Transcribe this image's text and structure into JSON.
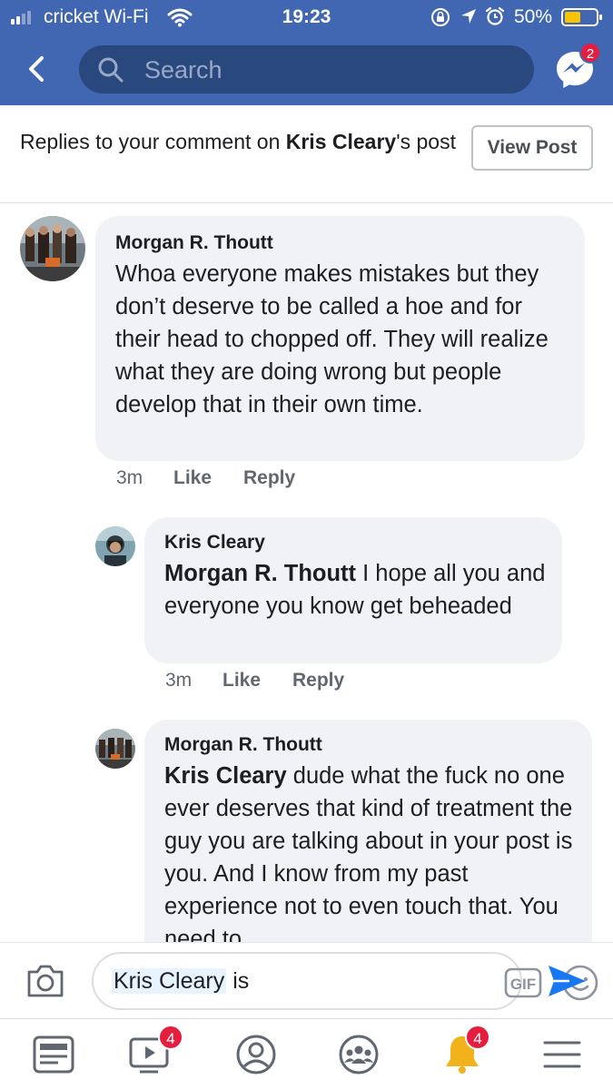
{
  "status_bar": {
    "carrier": "cricket Wi-Fi",
    "time": "19:23",
    "battery": "50%"
  },
  "header": {
    "search_placeholder": "Search",
    "messenger_badge": "2"
  },
  "notice": {
    "prefix": "Replies to your comment on ",
    "author": "Kris Cleary",
    "suffix": "'s post",
    "view_post": "View Post"
  },
  "comments": [
    {
      "name": "Morgan R. Thoutt",
      "mention": "",
      "text": "Whoa everyone makes mistakes but they don’t deserve to be called a hoe and for their head to chopped off. They will realize what they are doing wrong but people develop that in their own time.",
      "time": "3m",
      "like": "Like",
      "reply": "Reply"
    },
    {
      "name": "Kris Cleary",
      "mention": "Morgan R. Thoutt",
      "text": " I hope all you and everyone you know get beheaded",
      "time": "3m",
      "like": "Like",
      "reply": "Reply"
    },
    {
      "name": "Morgan R. Thoutt",
      "mention": "Kris Cleary",
      "text": " dude what the fuck no one ever deserves that kind of treatment the guy you are talking about in your post is you. And I know from my past experience not to even touch that. You need to"
    }
  ],
  "composer": {
    "tag": "Kris Cleary",
    "rest": " is",
    "gif_label": "GIF"
  },
  "tabbar": {
    "watch_badge": "4",
    "notifications_badge": "4"
  },
  "colors": {
    "header_blue": "#4267b2",
    "search_blue": "#29487d",
    "badge_red": "#e41e3f",
    "bubble_gray": "#f0f2f5",
    "send_blue": "#1877f2"
  }
}
